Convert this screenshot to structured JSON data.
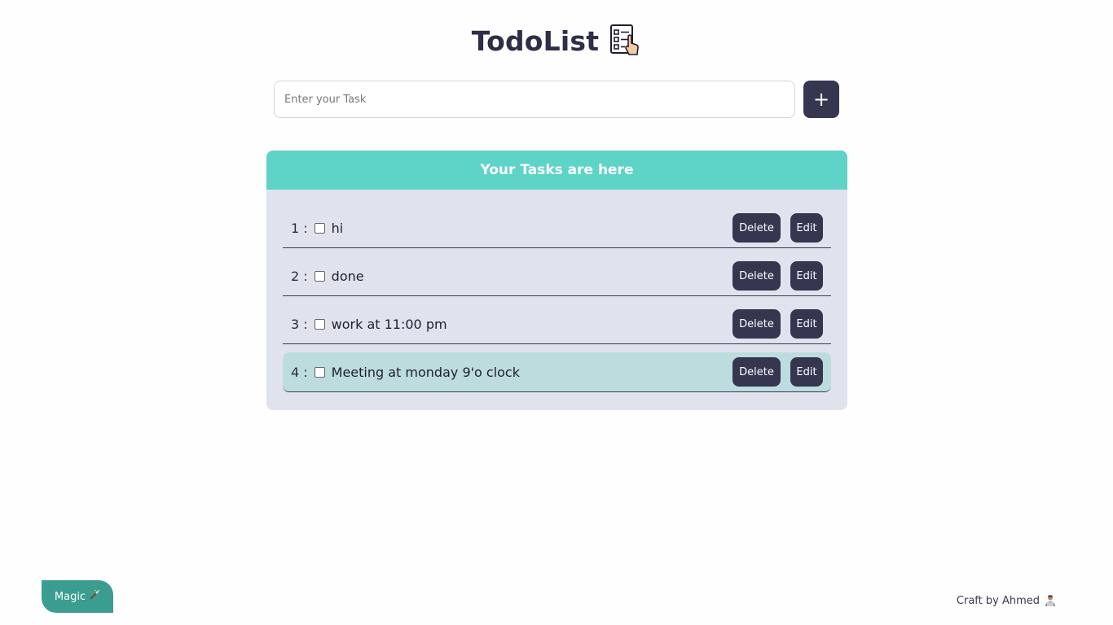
{
  "header": {
    "title": "TodoList",
    "logo_icon": "checklist-icon"
  },
  "input": {
    "placeholder": "Enter your Task",
    "value": "",
    "add_label": "+"
  },
  "panel": {
    "heading": "Your Tasks are here"
  },
  "tasks": [
    {
      "number": "1 :",
      "text": "hi",
      "checked": false,
      "delete_label": "Delete",
      "edit_label": "Edit"
    },
    {
      "number": "2 :",
      "text": "done",
      "checked": false,
      "delete_label": "Delete",
      "edit_label": "Edit"
    },
    {
      "number": "3 :",
      "text": "work at 11:00 pm",
      "checked": false,
      "delete_label": "Delete",
      "edit_label": "Edit"
    },
    {
      "number": "4 :",
      "text": "Meeting at monday 9'o clock",
      "checked": false,
      "delete_label": "Delete",
      "edit_label": "Edit"
    }
  ],
  "footer": {
    "magic_label": "Magic",
    "magic_icon": "magic-wand-icon",
    "credit": "Craft by Ahmed",
    "credit_icon": "person-icon"
  },
  "colors": {
    "primary": "#363651",
    "accent": "#5ed3c8",
    "panel_bg": "#e0e3ed",
    "highlight_row": "#bddcde",
    "magic": "#3a9d8f"
  }
}
